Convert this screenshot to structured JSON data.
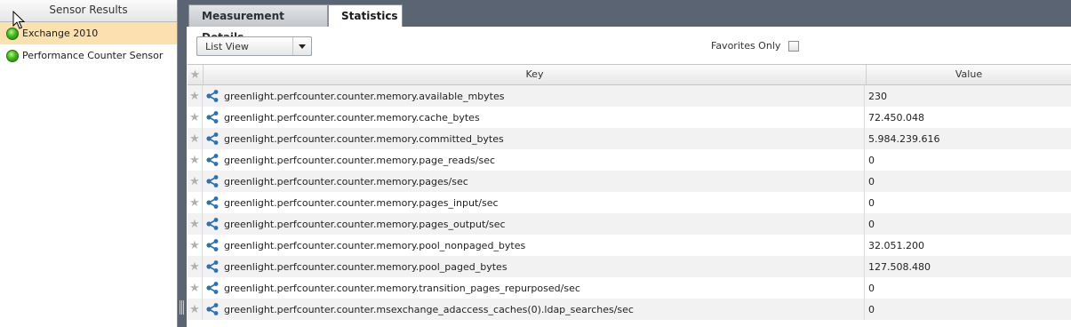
{
  "left_panel": {
    "title": "Sensor Results",
    "items": [
      {
        "label": "Exchange 2010",
        "selected": true
      },
      {
        "label": "Performance Counter Sensor",
        "selected": false
      }
    ]
  },
  "tabs": [
    {
      "label": "Measurement Details",
      "active": false
    },
    {
      "label": "Statistics",
      "active": true
    }
  ],
  "toolbar": {
    "view_select": "List View",
    "favorites_label": "Favorites Only"
  },
  "grid": {
    "columns": {
      "key": "Key",
      "value": "Value"
    },
    "rows": [
      {
        "key": "greenlight.perfcounter.counter.memory.available_mbytes",
        "value": "230"
      },
      {
        "key": "greenlight.perfcounter.counter.memory.cache_bytes",
        "value": "72.450.048"
      },
      {
        "key": "greenlight.perfcounter.counter.memory.committed_bytes",
        "value": "5.984.239.616"
      },
      {
        "key": "greenlight.perfcounter.counter.memory.page_reads/sec",
        "value": "0"
      },
      {
        "key": "greenlight.perfcounter.counter.memory.pages/sec",
        "value": "0"
      },
      {
        "key": "greenlight.perfcounter.counter.memory.pages_input/sec",
        "value": "0"
      },
      {
        "key": "greenlight.perfcounter.counter.memory.pages_output/sec",
        "value": "0"
      },
      {
        "key": "greenlight.perfcounter.counter.memory.pool_nonpaged_bytes",
        "value": "32.051.200"
      },
      {
        "key": "greenlight.perfcounter.counter.memory.pool_paged_bytes",
        "value": "127.508.480"
      },
      {
        "key": "greenlight.perfcounter.counter.memory.transition_pages_repurposed/sec",
        "value": "0"
      },
      {
        "key": "greenlight.perfcounter.counter.msexchange_adaccess_caches(0).ldap_searches/sec",
        "value": "0"
      }
    ]
  },
  "icons": {
    "status": "green-status-icon",
    "row": "share-node-icon",
    "favorite": "star-icon"
  },
  "colors": {
    "selected_row": "#fbe0b0",
    "dark_chrome": "#5a6472",
    "icon_blue": "#2f6fb5",
    "status_green": "#44b51c"
  }
}
